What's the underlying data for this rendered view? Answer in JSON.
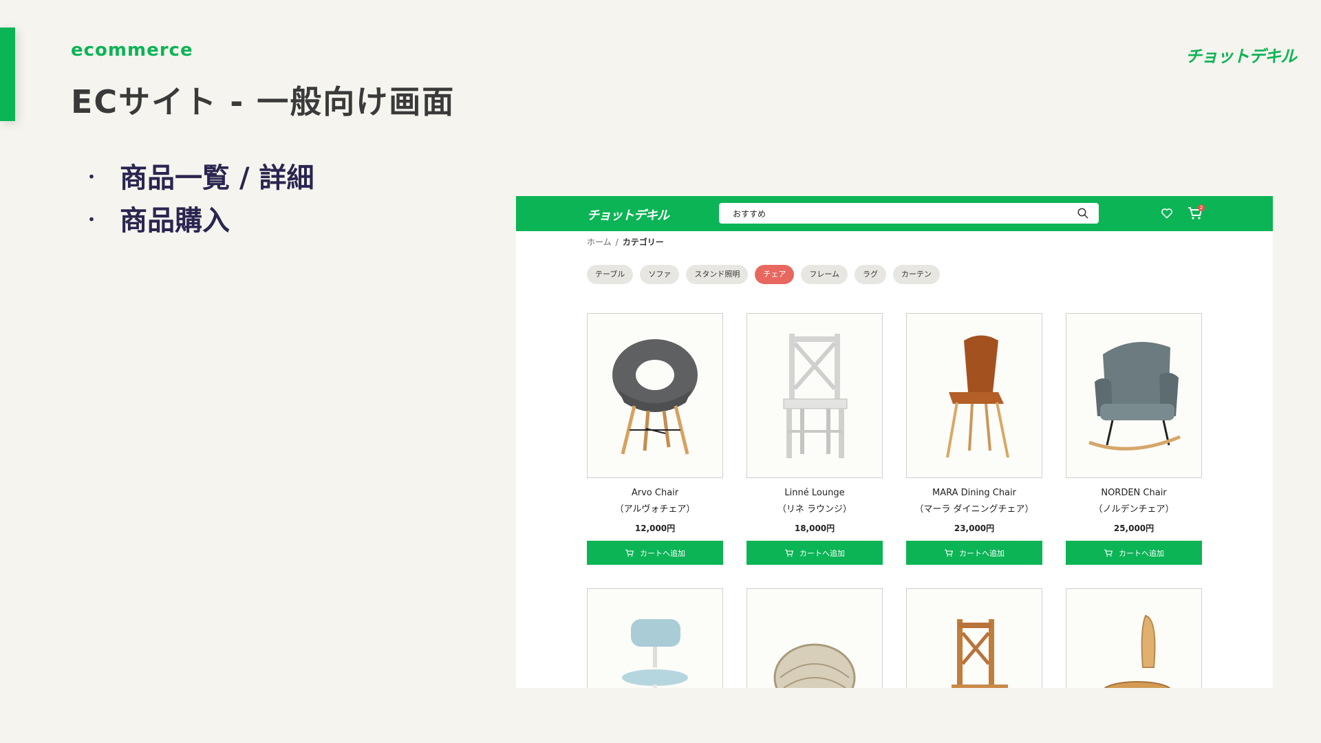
{
  "slide": {
    "eyebrow": "ecommerce",
    "title": "ECサイト - 一般向け画面",
    "logo": "チョットデキル",
    "bullets": [
      "商品一覧 / 詳細",
      "商品購入"
    ]
  },
  "site": {
    "logo": "チョットデキル",
    "search_value": "おすすめ",
    "cart_count": "2",
    "breadcrumb": {
      "home": "ホーム",
      "separator": "/",
      "current": "カテゴリー"
    },
    "categories": [
      "テーブル",
      "ソファ",
      "スタンド照明",
      "チェア",
      "フレーム",
      "ラグ",
      "カーテン"
    ],
    "active_category": "チェア",
    "add_to_cart_label": "カートへ追加",
    "products": [
      {
        "name": "Arvo Chair",
        "kana": "（アルヴォチェア）",
        "price": "12,000円"
      },
      {
        "name": "Linné Lounge",
        "kana": "（リネ ラウンジ）",
        "price": "18,000円"
      },
      {
        "name": "MARA Dining Chair",
        "kana": "（マーラ ダイニングチェア）",
        "price": "23,000円"
      },
      {
        "name": "NORDEN Chair",
        "kana": "（ノルデンチェア）",
        "price": "25,000円"
      }
    ]
  },
  "colors": {
    "brand_green": "#0bb455",
    "active_chip": "#e8685f",
    "bullet_text": "#2a2550"
  },
  "icons": [
    "search-icon",
    "heart-icon",
    "cart-icon"
  ]
}
